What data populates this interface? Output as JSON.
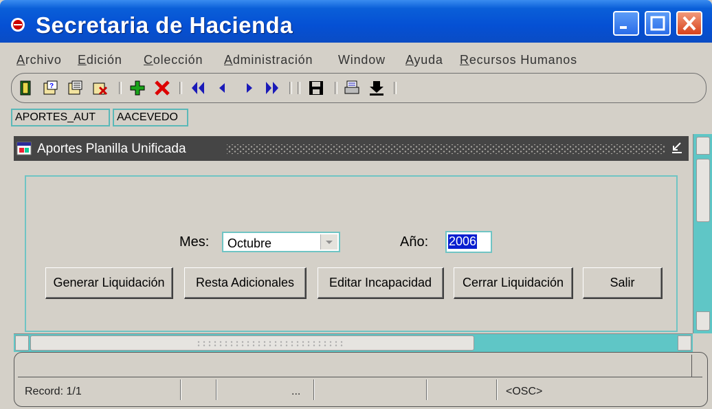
{
  "window": {
    "title": "Secretaria de Hacienda"
  },
  "menu": [
    {
      "label": "Archivo",
      "key": "A",
      "rest": "rchivo"
    },
    {
      "label": "Edición",
      "key": "E",
      "rest": "dición"
    },
    {
      "label": "Colección",
      "key": "C",
      "rest": "olección"
    },
    {
      "label": "Administración",
      "key": "A",
      "rest": "dministración"
    },
    {
      "label": "Window",
      "key": "",
      "rest": "Window"
    },
    {
      "label": "Ayuda",
      "key": "A",
      "rest": "yuda"
    },
    {
      "label": "Recursos Humanos",
      "key": "R",
      "rest": "ecursos Humanos"
    }
  ],
  "toolbar_icons": [
    "exit-door-icon",
    "query-icon",
    "query-execute-icon",
    "query-cancel-icon",
    "insert-record-icon",
    "delete-record-icon",
    "first-record-icon",
    "previous-record-icon",
    "next-record-icon",
    "last-record-icon",
    "save-icon",
    "print-icon",
    "download-icon"
  ],
  "status_fields": {
    "form_name": "APORTES_AUT",
    "user": "AACEVEDO"
  },
  "inner_window": {
    "title": "Aportes Planilla Unificada"
  },
  "form": {
    "mes_label": "Mes:",
    "mes_value": "Octubre",
    "anio_label": "Año:",
    "anio_value": "2006"
  },
  "buttons": {
    "generar": "Generar Liquidación",
    "resta": "Resta Adicionales",
    "editar": "Editar Incapacidad",
    "cerrar": "Cerrar Liquidación",
    "salir": "Salir"
  },
  "statusbar": {
    "record": "Record: 1/1",
    "ellipsis": "...",
    "mode": "<OSC>"
  },
  "colors": {
    "title_bar": "#0a5fd8",
    "accent_border": "#6fc4c4",
    "selection": "#0a1fd0"
  }
}
